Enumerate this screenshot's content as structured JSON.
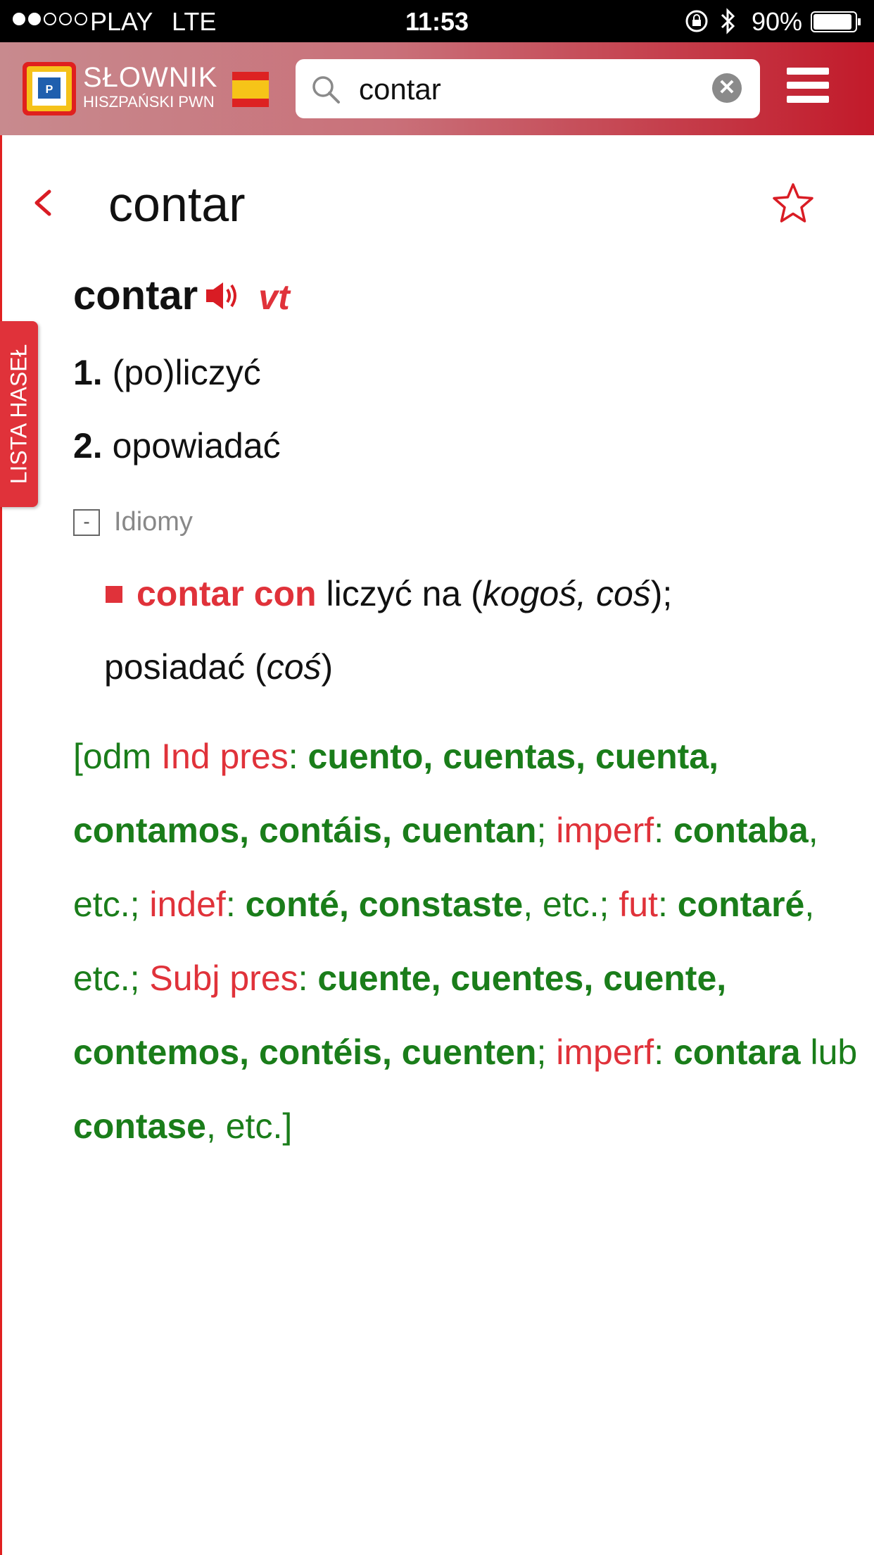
{
  "status_bar": {
    "carrier": "PLAY",
    "network": "LTE",
    "time": "11:53",
    "battery": "90%",
    "signal_bars_filled": 2,
    "signal_bars_total": 5
  },
  "header": {
    "logo_title": "SŁOWNIK",
    "logo_subtitle": "HISZPAŃSKI PWN",
    "search_value": "contar",
    "flag": "spain-flag-icon",
    "menu": "hamburger-menu-icon"
  },
  "side_tab": {
    "label": "LISTA HASEŁ"
  },
  "page": {
    "title": "contar"
  },
  "entry": {
    "headword": "contar",
    "pos": "vt",
    "senses": [
      {
        "num": "1.",
        "text": "(po)liczyć"
      },
      {
        "num": "2.",
        "text": "opowiadać"
      }
    ],
    "idioms_toggle": {
      "symbol": "-",
      "label": "Idiomy"
    },
    "idiom": {
      "term": "contar con",
      "t1": " liczyć na (",
      "t2": "kogoś, coś",
      "t3": ");",
      "l2a": "posiadać (",
      "l2b": "coś",
      "l2c": ")"
    },
    "inflection": {
      "open": "[odm ",
      "ind_pres": "Ind pres",
      "ind_pres_forms_1": "cuento, cuentas, cuenta, contamos, contáis, cuentan",
      "imperf": "imperf",
      "imperf_form": "contaba",
      "etc": ", etc.;",
      "indef": "indef",
      "indef_forms": "conté, constaste",
      "fut": "fut",
      "fut_form": "contaré",
      "subj_pres": "Subj pres",
      "subj_pres_forms": "cuente, cuentes, cuente, contemos, contéis, cuenten",
      "imperf2": "imperf",
      "imperf2_form_a": "contara",
      "lub": " lub ",
      "imperf2_form_b": "contase",
      "close": ", etc.]"
    }
  },
  "colors": {
    "accent_red": "#e0323a",
    "inflection_green": "#1a7d1a",
    "header_gradient_end": "#c21a2a"
  }
}
